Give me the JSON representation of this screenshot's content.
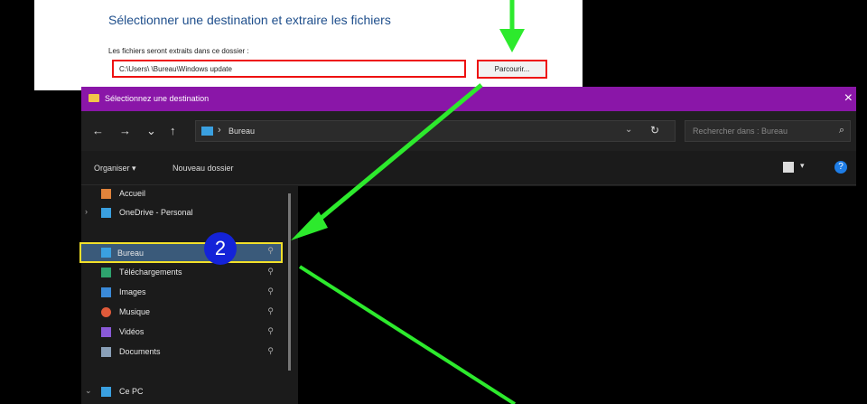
{
  "extract_dialog": {
    "title": "Sélectionner une destination et extraire les fichiers",
    "label": "Les fichiers seront extraits dans ce dossier :",
    "path_value": "C:\\Users\\        \\Bureau\\Windows update",
    "browse_label": "Parcourir..."
  },
  "explorer": {
    "window_title": "Sélectionnez une destination",
    "close_label": "×",
    "nav": {
      "back": "←",
      "forward": "→",
      "down": "⌄",
      "up": "↑"
    },
    "address_sep": "›",
    "address_crumb": "Bureau",
    "address_dropdown": "⌄",
    "refresh": "↻",
    "search_placeholder": "Rechercher dans : Bureau",
    "search_icon": "⌕",
    "organize_label": "Organiser ▾",
    "new_folder_label": "Nouveau dossier",
    "view_dropdown": "▾",
    "help_label": "?",
    "sidebar": [
      {
        "label": "Accueil",
        "icon": "home-icon",
        "color": "#e0833b"
      },
      {
        "label": "OneDrive - Personal",
        "icon": "cloud-icon",
        "color": "#3aa0e0",
        "chevron": "›"
      },
      {
        "label": "Bureau",
        "icon": "desktop-icon",
        "color": "#3aa0e0",
        "pin": "⚲",
        "selected": true
      },
      {
        "label": "Téléchargements",
        "icon": "download-icon",
        "color": "#2ea36e",
        "pin": "⚲"
      },
      {
        "label": "Images",
        "icon": "images-icon",
        "color": "#3a8ad8",
        "pin": "⚲"
      },
      {
        "label": "Musique",
        "icon": "music-icon",
        "color": "#e05a3a",
        "pin": "⚲"
      },
      {
        "label": "Vidéos",
        "icon": "video-icon",
        "color": "#8a5ad8",
        "pin": "⚲"
      },
      {
        "label": "Documents",
        "icon": "documents-icon",
        "color": "#8aa0b8",
        "pin": "⚲"
      },
      {
        "label": "Ce PC",
        "icon": "pc-icon",
        "color": "#3aa0e0",
        "chevron": "⌄"
      }
    ],
    "step_badge": "2"
  }
}
